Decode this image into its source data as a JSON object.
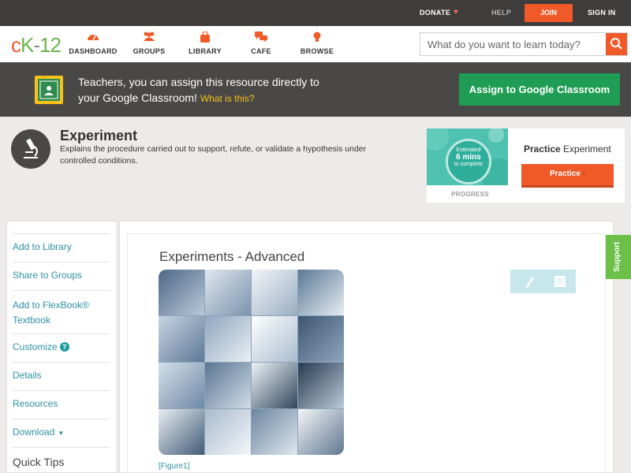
{
  "topbar": {
    "donate": "DONATE",
    "help": "HELP",
    "join": "JOIN",
    "signin": "SIGN IN"
  },
  "logo": {
    "c": "c",
    "k": "K",
    "dash": "-",
    "num": "12"
  },
  "nav": {
    "items": [
      {
        "label": "DASHBOARD",
        "icon": "dashboard-gauge-icon"
      },
      {
        "label": "GROUPS",
        "icon": "groups-people-icon"
      },
      {
        "label": "LIBRARY",
        "icon": "library-bag-icon"
      },
      {
        "label": "CAFE",
        "icon": "cafe-chat-icon"
      },
      {
        "label": "BROWSE",
        "icon": "browse-bulb-icon"
      }
    ]
  },
  "search": {
    "placeholder": "What do you want to learn today?"
  },
  "banner": {
    "line1": "Teachers, you can assign this resource directly to",
    "line2": "your Google Classroom!",
    "what": "What is this?",
    "assign_label": "Assign to Google Classroom"
  },
  "concept": {
    "title": "Experiment",
    "description": "Explains the procedure carried out to support, refute, or validate a hypothesis under controlled conditions."
  },
  "practice": {
    "estimated": "Estimated",
    "mins": "6 mins",
    "to_complete": "to complete",
    "progress_label": "PROGRESS",
    "title_bold": "Practice",
    "title_rest": "Experiment",
    "button_label": "Practice"
  },
  "sidebar": {
    "items": [
      {
        "label": "Add to Library"
      },
      {
        "label": "Share to Groups"
      },
      {
        "label": "Add to FlexBook®"
      },
      {
        "label": "Textbook"
      },
      {
        "label": "Customize"
      },
      {
        "label": "Details"
      },
      {
        "label": "Resources"
      },
      {
        "label": "Download"
      }
    ],
    "help_mark": "?",
    "quick_tips": "Quick Tips"
  },
  "article": {
    "title": "Experiments - Advanced",
    "figure_caption": "[Figure1]"
  },
  "support": {
    "label": "Support"
  },
  "colors": {
    "brand_orange": "#f05a28",
    "brand_green": "#6cb44e",
    "assign_green": "#1f9d55",
    "link_teal": "#2e8fa6"
  }
}
